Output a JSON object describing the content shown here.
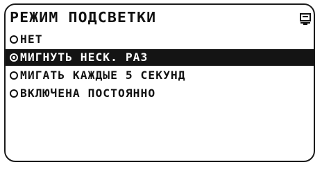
{
  "screen": {
    "title": "РЕЖИМ ПОДСВЕТКИ",
    "title_icon": "menu-list-icon"
  },
  "menu": {
    "items": [
      {
        "label": "НЕТ",
        "selected": false
      },
      {
        "label": "МИГНУТЬ НЕСК. РАЗ",
        "selected": true
      },
      {
        "label": "МИГАТЬ КАЖДЫЕ 5 СЕКУНД",
        "selected": false
      },
      {
        "label": "ВКЛЮЧЕНА ПОСТОЯННО",
        "selected": false
      }
    ]
  },
  "colors": {
    "foreground": "#111111",
    "background": "#ffffff",
    "highlight": "#141414"
  }
}
